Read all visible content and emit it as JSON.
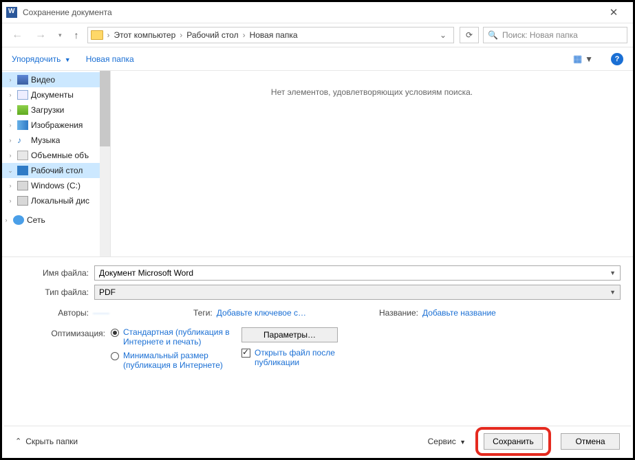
{
  "window": {
    "title": "Сохранение документа"
  },
  "breadcrumb": {
    "items": [
      "Этот компьютер",
      "Рабочий стол",
      "Новая папка"
    ]
  },
  "search": {
    "placeholder": "Поиск: Новая папка"
  },
  "toolbar": {
    "organize": "Упорядочить",
    "new_folder": "Новая папка"
  },
  "sidebar": {
    "items": [
      {
        "label": "Видео",
        "icon": "film",
        "sel": true
      },
      {
        "label": "Документы",
        "icon": "doc"
      },
      {
        "label": "Загрузки",
        "icon": "dl"
      },
      {
        "label": "Изображения",
        "icon": "img"
      },
      {
        "label": "Музыка",
        "icon": "mus"
      },
      {
        "label": "Объемные объ",
        "icon": "vol"
      },
      {
        "label": "Рабочий стол",
        "icon": "desk",
        "sel": true,
        "exp": true
      },
      {
        "label": "Windows (C:)",
        "icon": "drv"
      },
      {
        "label": "Локальный дис",
        "icon": "drv"
      }
    ],
    "network": "Сеть"
  },
  "content": {
    "empty": "Нет элементов, удовлетворяющих условиям поиска."
  },
  "form": {
    "filename_label": "Имя файла:",
    "filename_value": "Документ Microsoft Word",
    "filetype_label": "Тип файла:",
    "filetype_value": "PDF",
    "authors_label": "Авторы:",
    "authors_value": "——",
    "tags_label": "Теги:",
    "tags_link": "Добавьте ключевое с…",
    "title_label": "Название:",
    "title_link": "Добавьте название"
  },
  "optimize": {
    "label": "Оптимизация:",
    "opt1": "Стандартная (публикация в Интернете и печать)",
    "opt2": "Минимальный размер (публикация в Интернете)",
    "params_btn": "Параметры…",
    "open_after": "Открыть файл после публикации"
  },
  "footer": {
    "hide": "Скрыть папки",
    "service": "Сервис",
    "save": "Сохранить",
    "cancel": "Отмена"
  }
}
